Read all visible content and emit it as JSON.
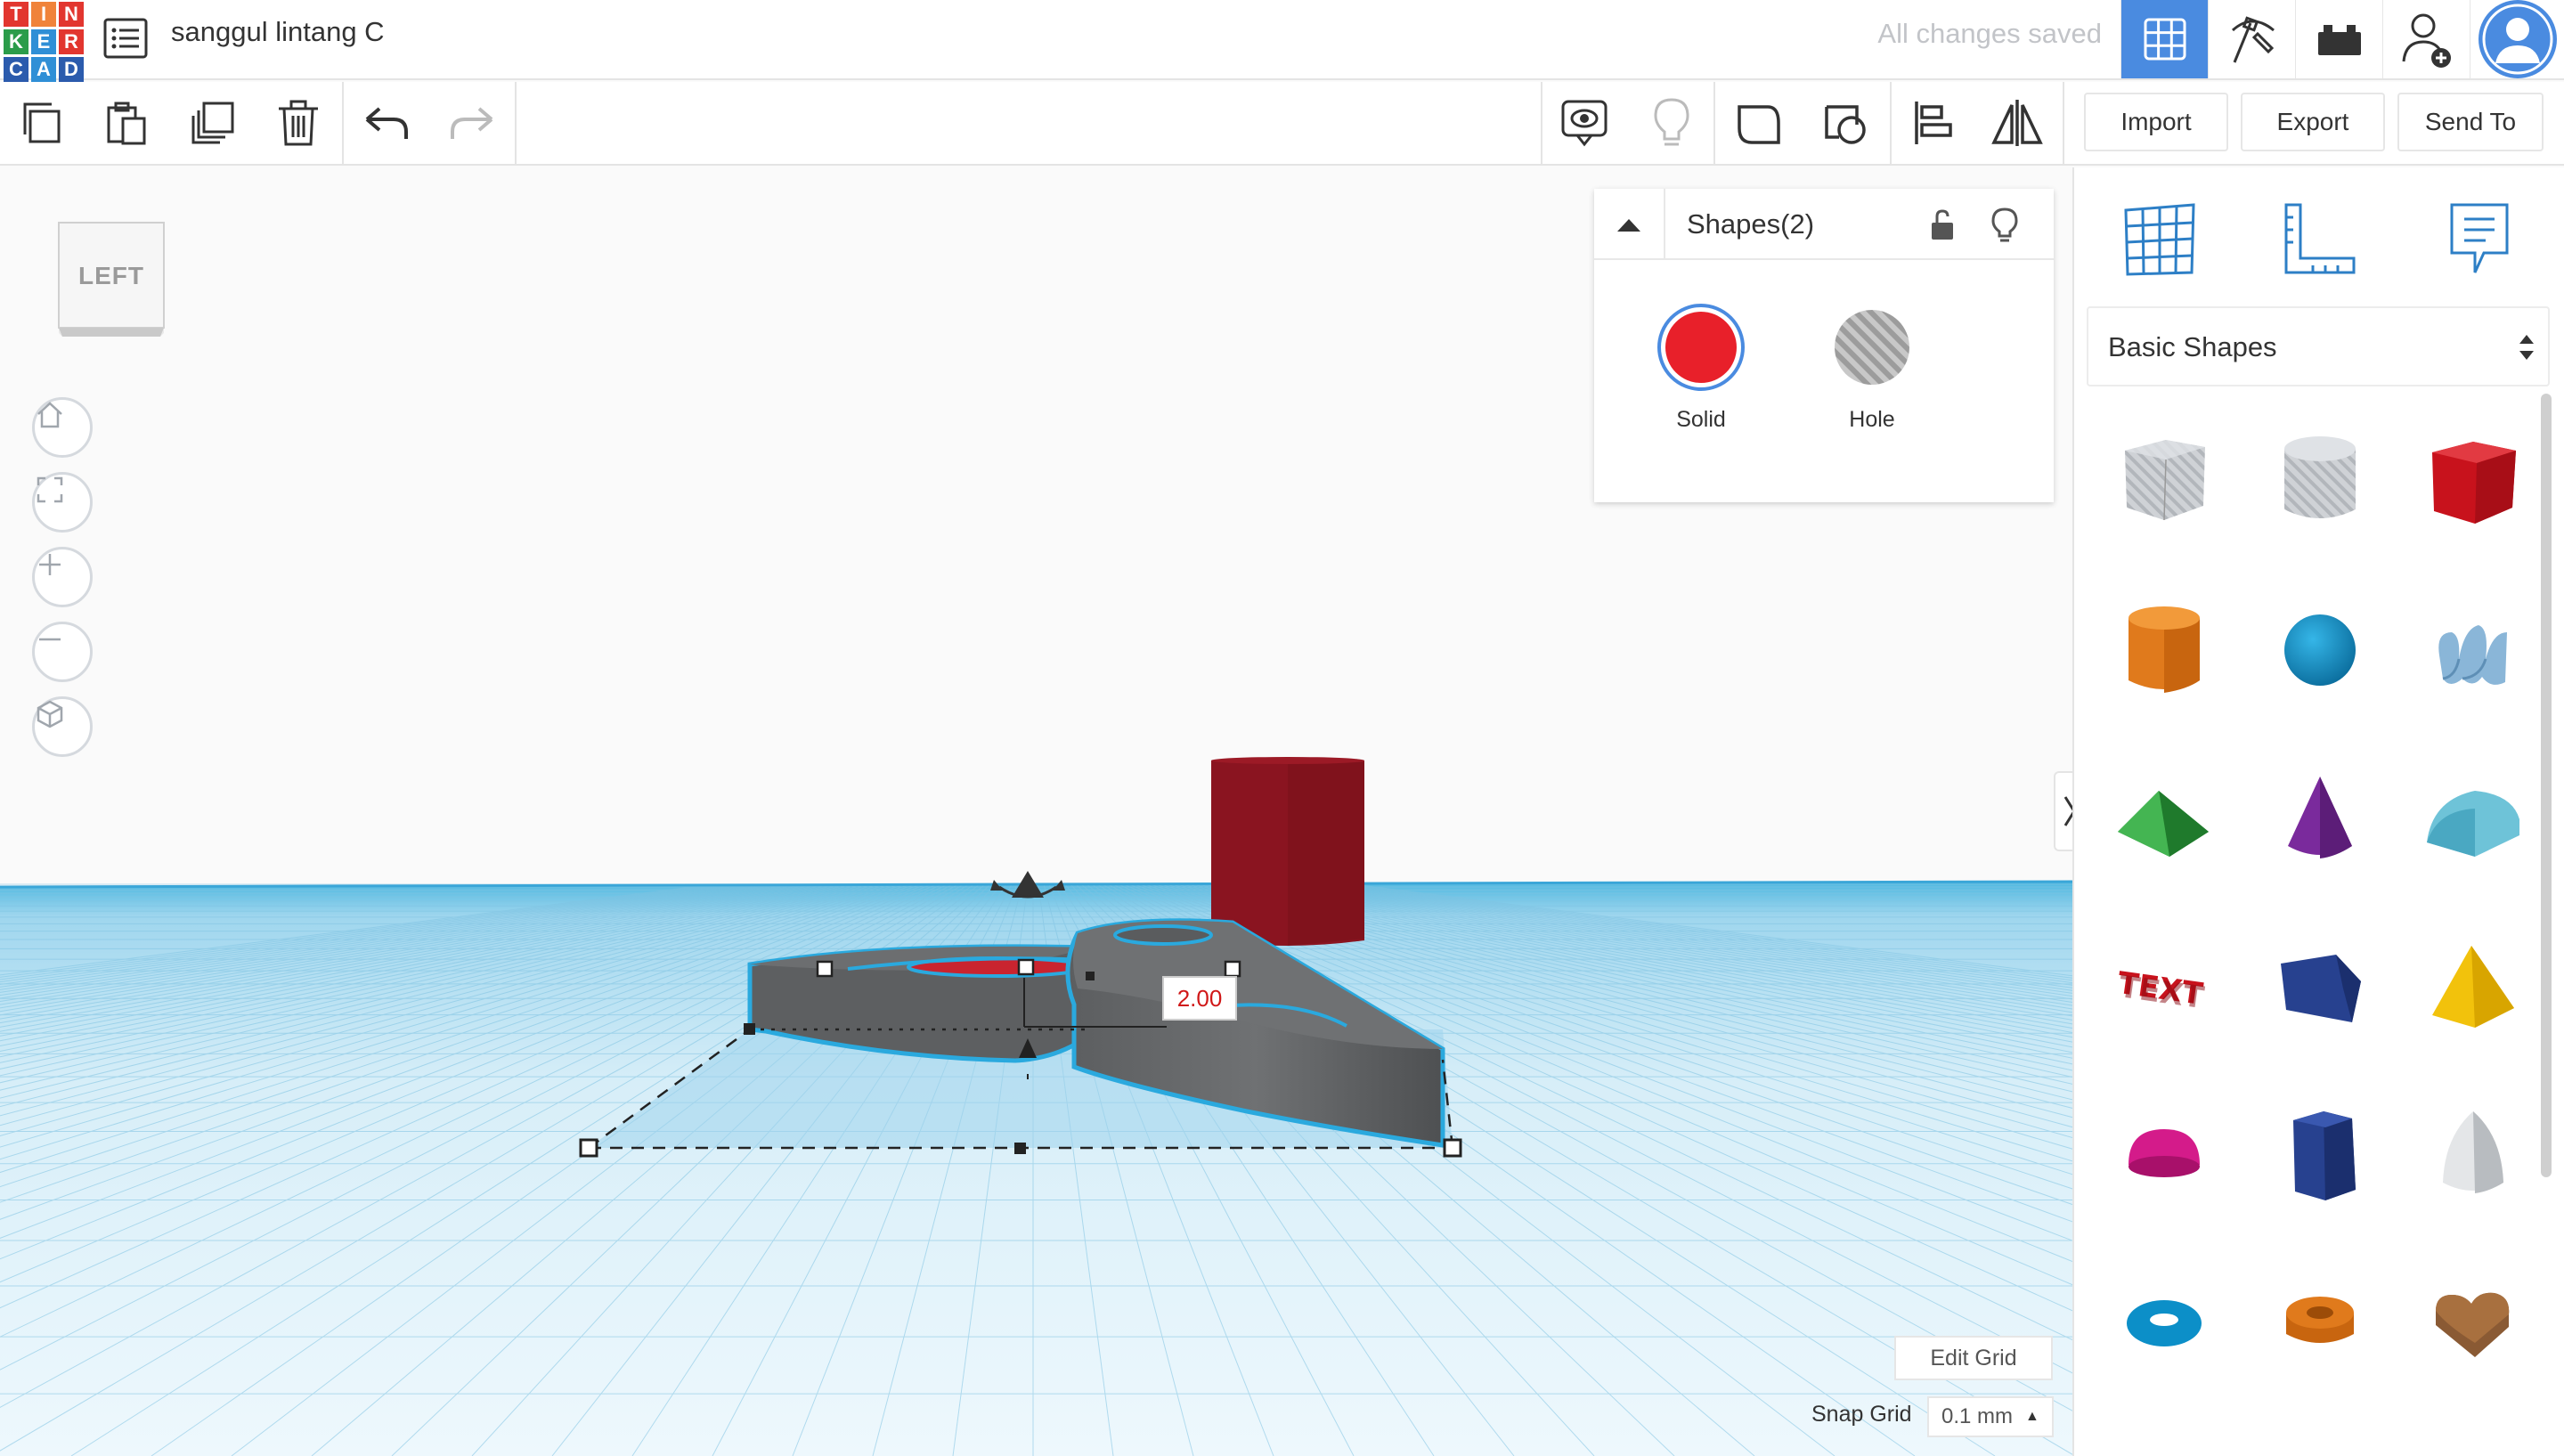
{
  "app": {
    "logo_letters": [
      "T",
      "I",
      "N",
      "K",
      "E",
      "R",
      "C",
      "A",
      "D"
    ],
    "logo_colors": [
      "#e2362f",
      "#e2362f",
      "#e2362f",
      "#2f8fd6",
      "#2f8fd6",
      "#2f8fd6",
      "#2b5bad",
      "#2b5bad",
      "#2b5bad"
    ],
    "design_title": "sanggul lintang C",
    "save_status": "All changes saved",
    "accent": "#4a8be0"
  },
  "topbar": {
    "buttons": [
      "3d-design-grid-icon",
      "tinker-pickaxe-icon",
      "bricks-icon",
      "invite-user-icon",
      "profile-avatar-icon"
    ]
  },
  "toolbar": {
    "import_label": "Import",
    "export_label": "Export",
    "send_to_label": "Send To"
  },
  "viewcube": {
    "face_label": "LEFT"
  },
  "inspector": {
    "title": "Shapes(2)",
    "solid_label": "Solid",
    "hole_label": "Hole",
    "solid_color": "#e8202a"
  },
  "library": {
    "selected": "Basic Shapes",
    "shapes": [
      "box-hole",
      "cylinder-hole",
      "box",
      "cylinder",
      "sphere",
      "scribble",
      "roof",
      "cone",
      "round-roof",
      "text",
      "polygon",
      "pyramid",
      "half-sphere",
      "hexagonal-prism",
      "paraboloid",
      "torus",
      "tube",
      "heart"
    ]
  },
  "workplane": {
    "dimension_value": "2.00",
    "edit_grid_label": "Edit Grid",
    "snap_grid_label": "Snap Grid",
    "snap_grid_value": "0.1 mm"
  }
}
